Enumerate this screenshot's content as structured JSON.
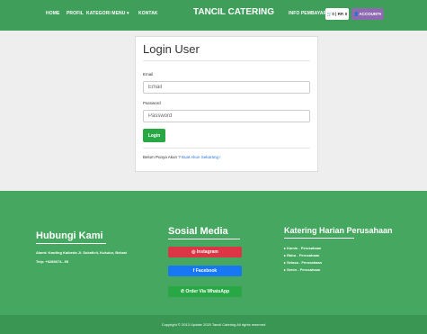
{
  "navbar": {
    "links": [
      "HOME",
      "PROFIL",
      "KATEGORI MENU",
      "KONTAK"
    ],
    "dropdown_caret": "▾",
    "brand": "TANCIL CATERING",
    "info_link": "INFO PEMBAYARAN",
    "cart_label": "0 | RP. 0",
    "account_label": "ACCOUNT",
    "colors": {
      "navbar": "#3e9e5a",
      "account": "#8e6bb1"
    }
  },
  "login": {
    "title": "Login User",
    "email_label": "Email",
    "email_placeholder": "Email",
    "password_label": "Password",
    "password_placeholder": "Password",
    "button_label": "Login",
    "register_prefix": "Belum Punya Akun ? ",
    "register_link": "Buat Akun Sekarang !"
  },
  "footer": {
    "contact": {
      "title": "Hubungi Kami",
      "address": "Alamt: Kawling Kaibeda Jl. Sukaficit, Kukulur, Bekasi",
      "phone": "Telp: +6289674...95"
    },
    "social": {
      "title": "Sosial Media",
      "instagram": "Instagram",
      "facebook": "Facebook",
      "whatsapp": "Order Via WhatsApp",
      "colors": {
        "instagram": "#dc3545",
        "facebook": "#1877f2",
        "whatsapp": "#28a745"
      }
    },
    "catering": {
      "title": "Katering Harian Perusahaan",
      "items": [
        "Kamis - Perusahaan",
        "Rabu - Perusahaan",
        "Selasa - Perusahaan",
        "Senin - Perusahaan"
      ]
    },
    "copyright": "Copyright © 2013 Update 2020 Tancil Catering All rights reserved"
  }
}
